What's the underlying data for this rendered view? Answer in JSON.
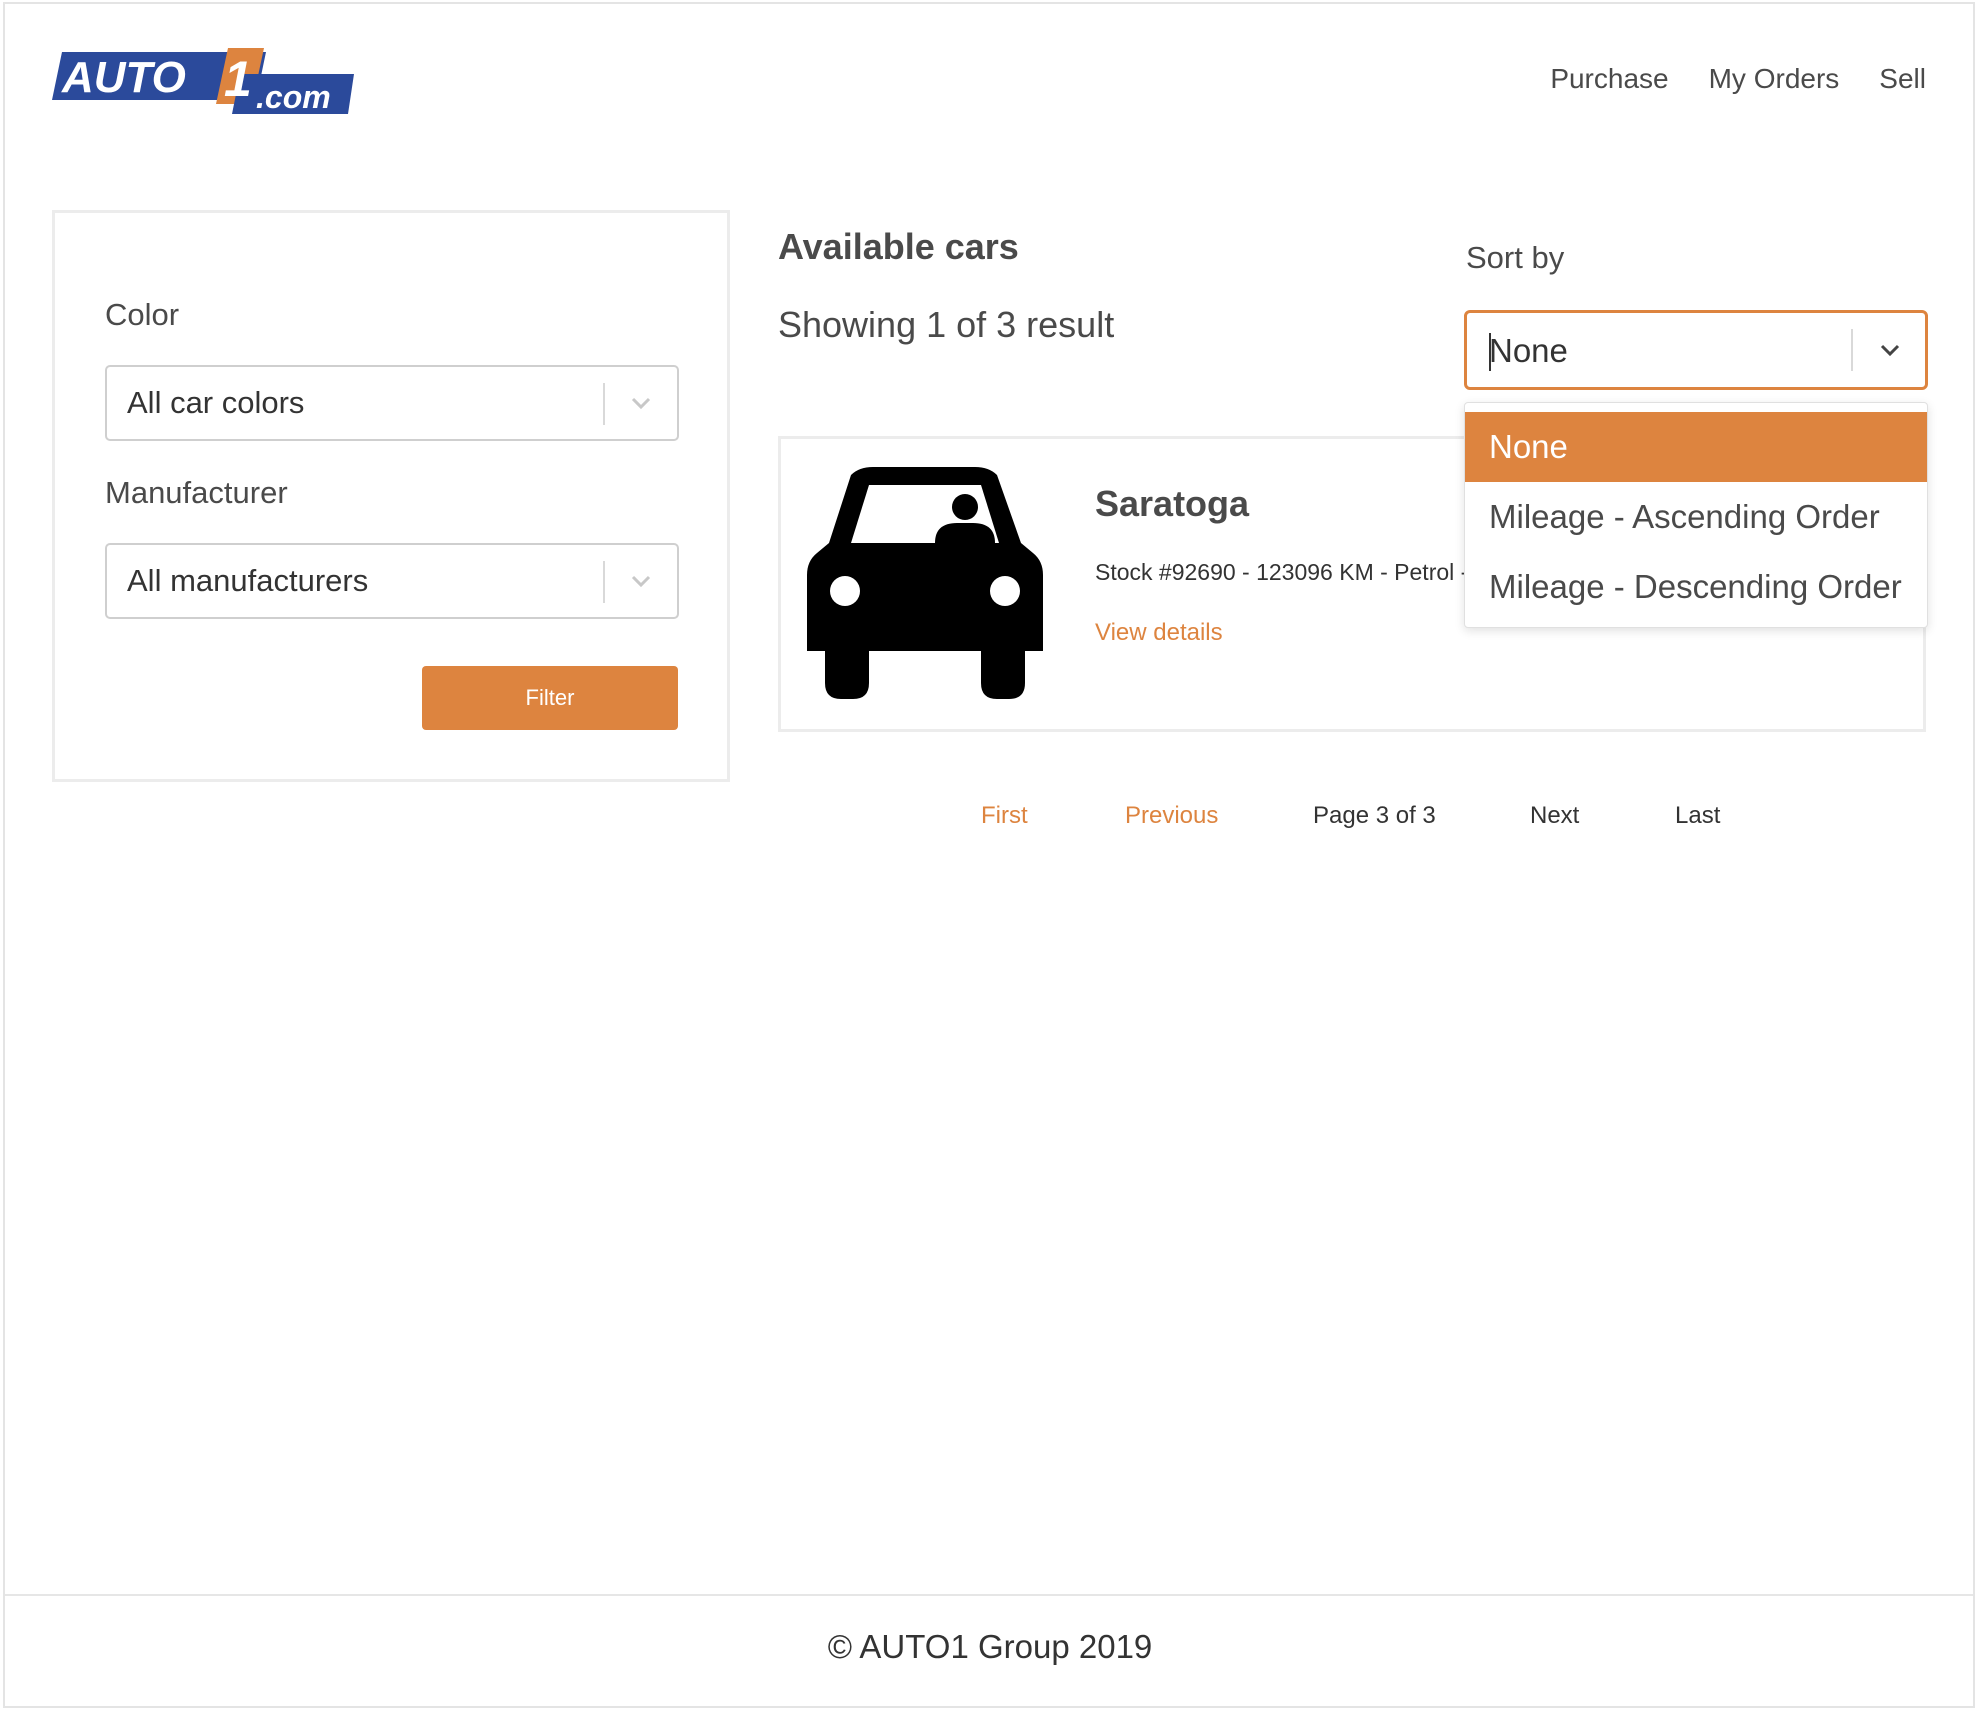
{
  "header": {
    "logo_text_main": "AUTO",
    "logo_text_num": "1",
    "logo_text_suffix": ".com",
    "nav": [
      "Purchase",
      "My Orders",
      "Sell"
    ]
  },
  "filters": {
    "color_label": "Color",
    "color_value": "All car colors",
    "manufacturer_label": "Manufacturer",
    "manufacturer_value": "All manufacturers",
    "filter_button": "Filter"
  },
  "main": {
    "title": "Available cars",
    "result_count": "Showing 1 of 3 result"
  },
  "sort": {
    "label": "Sort by",
    "value": "None",
    "options": [
      "None",
      "Mileage - Ascending Order",
      "Mileage - Descending Order"
    ]
  },
  "car": {
    "name": "Saratoga",
    "meta": "Stock #92690 - 123096 KM - Petrol - Blue",
    "link": "View details",
    "icon": "car-icon"
  },
  "pagination": {
    "first": "First",
    "previous": "Previous",
    "info": "Page 3 of 3",
    "next": "Next",
    "last": "Last"
  },
  "footer": {
    "copyright": "© AUTO1 Group 2019"
  },
  "colors": {
    "accent": "#dd843f",
    "logo_blue": "#2b4a9b"
  }
}
